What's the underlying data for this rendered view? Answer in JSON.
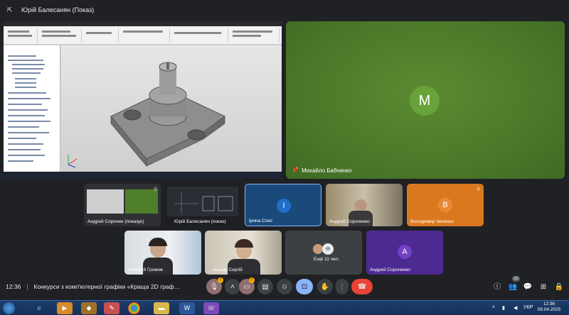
{
  "presenter": {
    "title": "Юрій Балесанян (Показ)",
    "icon": "presenting-icon"
  },
  "speaker": {
    "initial": "М",
    "name": "Михайло Бабченко",
    "avatar_color": "#6aa23a"
  },
  "tiles_row1": [
    {
      "name": "Андрей Сорочин (показує)",
      "type": "screen"
    },
    {
      "name": "Юрій Балесанян (показ)",
      "type": "screen"
    },
    {
      "name": "Ірина Спис",
      "type": "avatar",
      "initial": "І",
      "bg": "#1a4a7a",
      "avatar_color": "#1f6fc7"
    },
    {
      "name": "Андрей Сороченко",
      "type": "camera"
    },
    {
      "name": "Володимир Зеленко",
      "type": "avatar",
      "initial": "В",
      "bg": "#d9781e",
      "avatar_color": "#e8893a"
    }
  ],
  "tiles_row2": [
    {
      "name": "Алексей Громов",
      "type": "camera"
    },
    {
      "name": "…вський Сергій",
      "type": "camera"
    },
    {
      "name": "Ещё 11 чел.",
      "type": "more"
    },
    {
      "name": "Андрей Сороченко",
      "type": "avatar",
      "initial": "А",
      "bg": "#4c2a92",
      "avatar_color": "#7340c4"
    }
  ],
  "meeting": {
    "time": "12:36",
    "title": "Конкурси з комп'ютерної графіки «Краща 2D граф…"
  },
  "participants_count": "21",
  "taskbar": {
    "time": "12:36",
    "date": "09.04.2025",
    "lang": "УКР"
  },
  "colors": {
    "end_call": "#ea4335",
    "active_button": "#8ab4f8",
    "warning": "#f9ab00"
  }
}
